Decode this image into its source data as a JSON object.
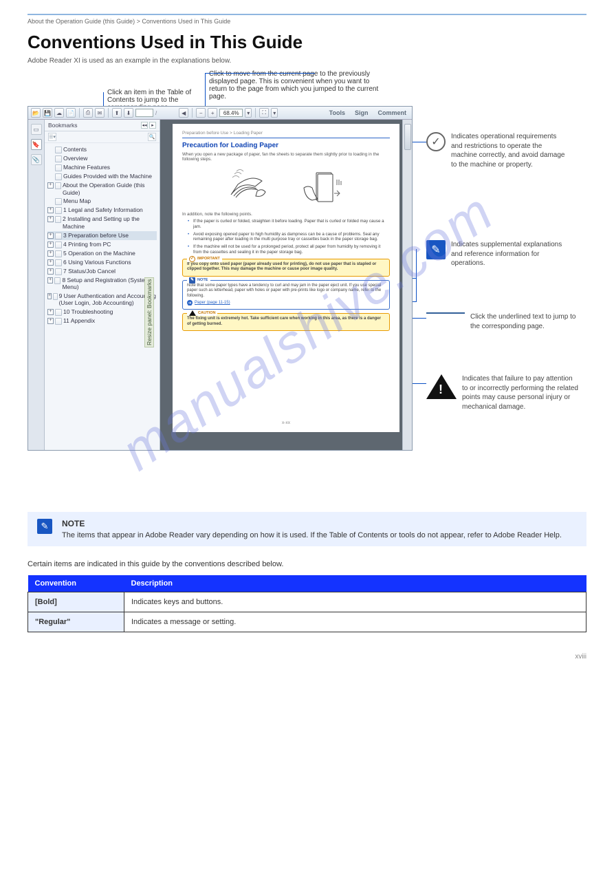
{
  "breadcrumb": "About the Operation Guide (this Guide) > Conventions Used in This Guide",
  "main_heading": "Conventions Used in This Guide",
  "lead": "Adobe Reader XI is used as an example in the explanations below.",
  "callouts": {
    "c1": "Click an item in the Table of Contents to jump to the corresponding page.",
    "c2": "Click to move from the current page to the previously displayed page. This is convenient when you want to return to the page from which you jumped to the current page.",
    "c3": "Indicates operational requirements and restrictions to operate the machine correctly, and avoid damage to the machine or property.",
    "c4": "Indicates supplemental explanations and reference information for operations.",
    "c5": "Click the underlined text to jump to the corresponding page.",
    "c6": "Indicates that failure to pay attention to or incorrectly performing the related points may cause personal injury or mechanical damage."
  },
  "viewer": {
    "zoom": "68.4%",
    "tools": "Tools",
    "sign": "Sign",
    "comment": "Comment",
    "bookmarks_title": "Bookmarks",
    "nodes": [
      {
        "exp": "",
        "label": "Contents"
      },
      {
        "exp": "",
        "label": "Overview"
      },
      {
        "exp": "",
        "label": "Machine Features"
      },
      {
        "exp": "",
        "label": "Guides Provided with the Machine"
      },
      {
        "exp": "+",
        "label": "About the Operation Guide (this Guide)"
      },
      {
        "exp": "",
        "label": "Menu Map"
      },
      {
        "exp": "+",
        "label": "1 Legal and Safety Information"
      },
      {
        "exp": "+",
        "label": "2 Installing and Setting up the Machine"
      },
      {
        "exp": "+",
        "label": "3 Preparation before Use",
        "sel": true
      },
      {
        "exp": "+",
        "label": "4 Printing from PC"
      },
      {
        "exp": "+",
        "label": "5 Operation on the Machine"
      },
      {
        "exp": "+",
        "label": "6 Using Various Functions"
      },
      {
        "exp": "+",
        "label": "7 Status/Job Cancel"
      },
      {
        "exp": "+",
        "label": "8 Setup and Registration (System Menu)"
      },
      {
        "exp": "+",
        "label": "9 User Authentication and Accounting (User Login, Job Accounting)"
      },
      {
        "exp": "+",
        "label": "10 Troubleshooting"
      },
      {
        "exp": "+",
        "label": "11 Appendix"
      }
    ],
    "resize_label": "Resize panel: Bookmarks"
  },
  "pdfpage": {
    "breadcrumb": "Preparation before Use > Loading Paper",
    "title": "Precaution for Loading Paper",
    "intro": "When you open a new package of paper, fan the sheets to separate them slightly prior to loading in the following steps.",
    "addition": "In addition, note the following points.",
    "bullets": [
      "If the paper is curled or folded, straighten it before loading. Paper that is curled or folded may cause a jam.",
      "Avoid exposing opened paper to high humidity as dampness can be a cause of problems. Seal any remaining paper after loading in the multi purpose tray or cassettes back in the paper storage bag.",
      "If the machine will not be used for a prolonged period, protect all paper from humidity by removing it from the cassettes and sealing it in the paper storage bag."
    ],
    "important_tag": "IMPORTANT",
    "important_body": "If you copy onto used paper (paper already used for printing), do not use paper that is stapled or clipped together. This may damage the machine or cause poor image quality.",
    "note_tag": "NOTE",
    "note_body": "Note that some paper types have a tendency to curl and may jam in the paper eject unit. If you use special paper such as letterhead, paper with holes or paper with pre-prints like logo or company name, refer to the following.",
    "note_link": "Paper (page 11-15)",
    "caution_tag": "CAUTION",
    "caution_body": "The fixing unit is extremely hot. Take sufficient care when working in this area, as there is a danger of getting burned.",
    "page_number": "x-xx"
  },
  "lower_note": {
    "title": "NOTE",
    "body": "The items that appear in Adobe Reader vary depending on how it is used. If the Table of Contents or tools do not appear, refer to Adobe Reader Help."
  },
  "conv_intro": "Certain items are indicated in this guide by the conventions described below.",
  "table": {
    "h1": "Convention",
    "h2": "Description",
    "r1k": "[Bold]",
    "r1v": "Indicates keys and buttons.",
    "r2k": "\"Regular\"",
    "r2v": "Indicates a message or setting."
  },
  "footer": "xviii",
  "watermark": "manualshive.com"
}
